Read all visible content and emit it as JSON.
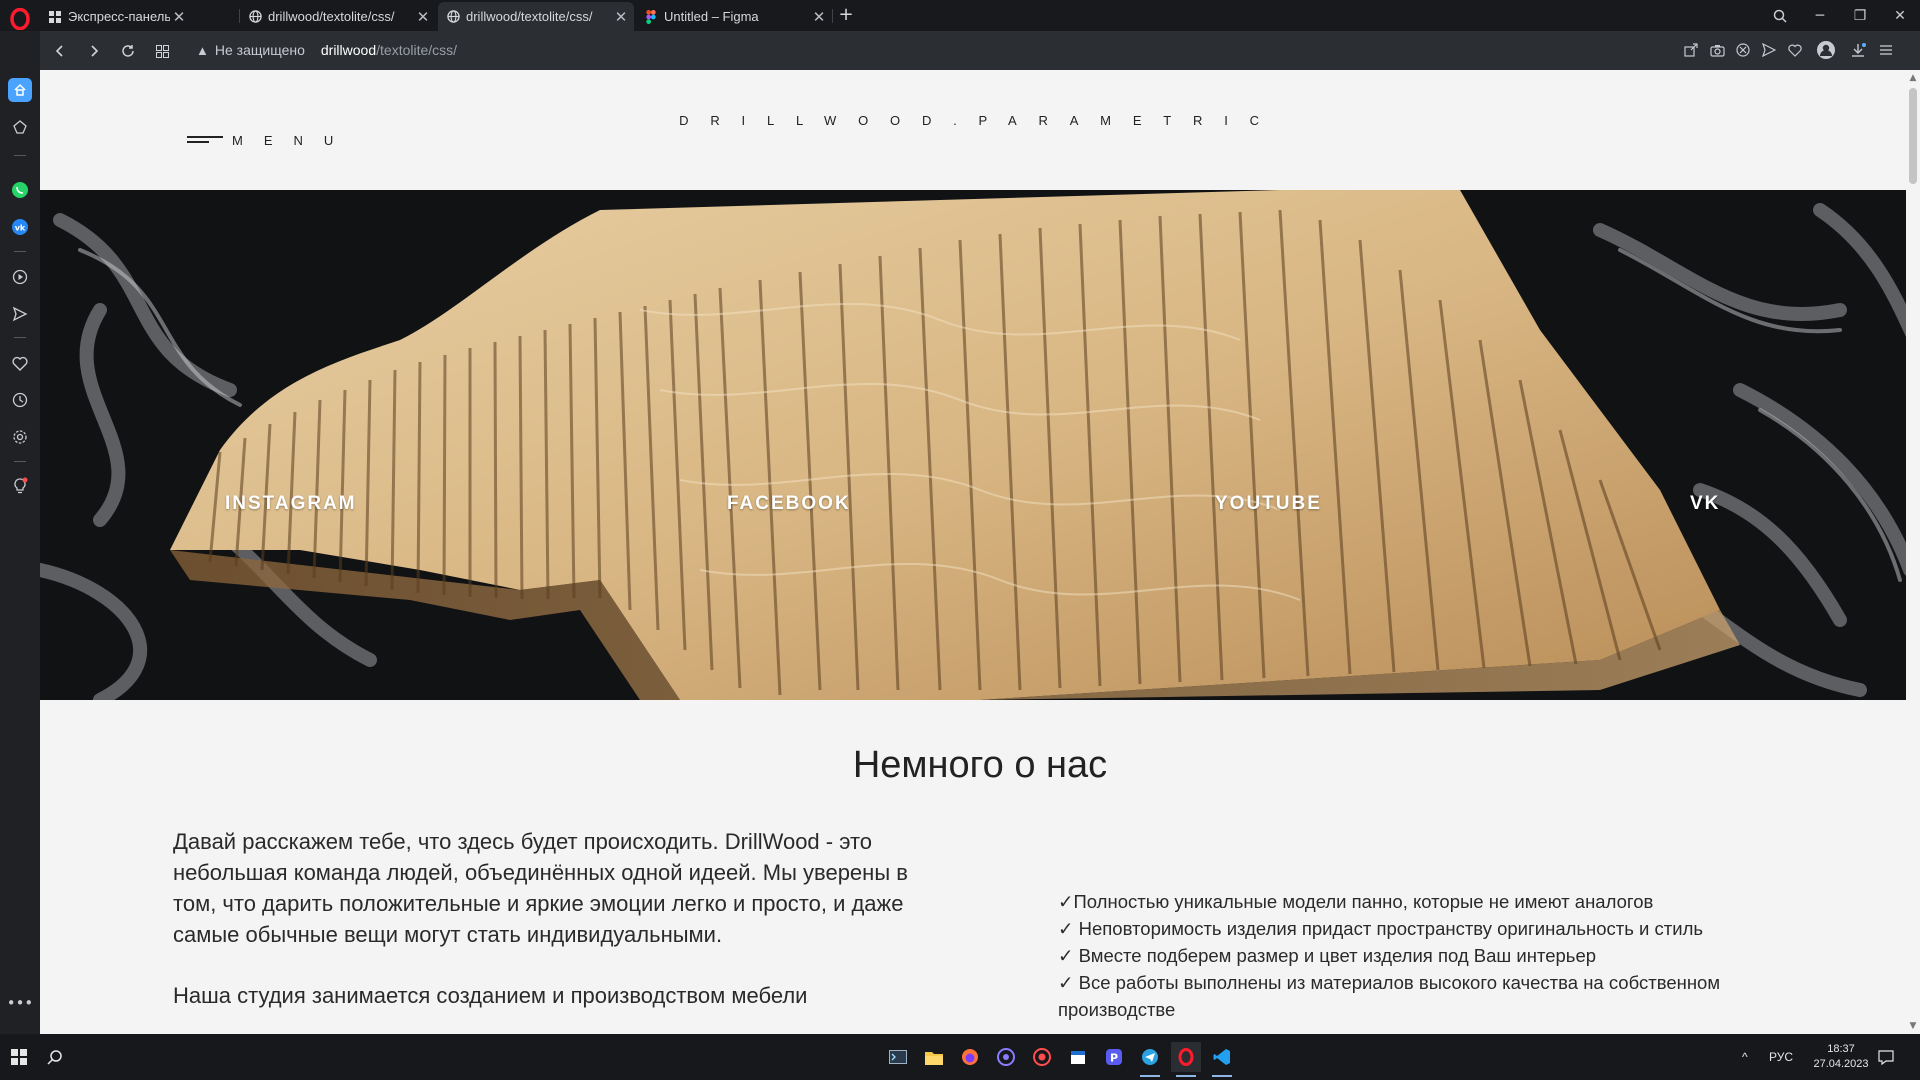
{
  "browser": {
    "tabs": [
      {
        "title": "Экспресс-панель",
        "icon": "grid-icon"
      },
      {
        "title": "drillwood/textolite/css/",
        "icon": "globe-icon"
      },
      {
        "title": "drillwood/textolite/css/",
        "icon": "globe-icon",
        "active": true
      },
      {
        "title": "Untitled – Figma",
        "icon": "figma-icon"
      }
    ],
    "security_label": "Не защищено",
    "url_host": "drillwood",
    "url_path": "/textolite/css/"
  },
  "site": {
    "menu_label": "MENU",
    "brand": "DRILLWOOD.PARAMETRIC",
    "social": [
      "INSTAGRAM",
      "FACEBOOK",
      "YOUTUBE",
      "VK"
    ],
    "about_title": "Немного о нас",
    "about_paragraphs": [
      "Давай расскажем тебе, что здесь будет происходить. DrillWood - это небольшая команда людей, объединённых одной идеей. Мы уверены в том, что дарить положительные и яркие эмоции легко и просто, и даже самые обычные вещи могут стать индивидуальными.",
      "Наша студия занимается созданием и производством мебели"
    ],
    "features": [
      "✓Полностью уникальные модели панно, которые не имеют аналогов",
      "✓ Неповторимость изделия придаст пространству оригинальность и стиль",
      "✓ Вместе подберем размер и цвет изделия под Ваш интерьер",
      "✓ Все работы выполнены из материалов высокого качества на собственном производстве"
    ]
  },
  "taskbar": {
    "language": "РУС",
    "time": "18:37",
    "date": "27.04.2023"
  }
}
